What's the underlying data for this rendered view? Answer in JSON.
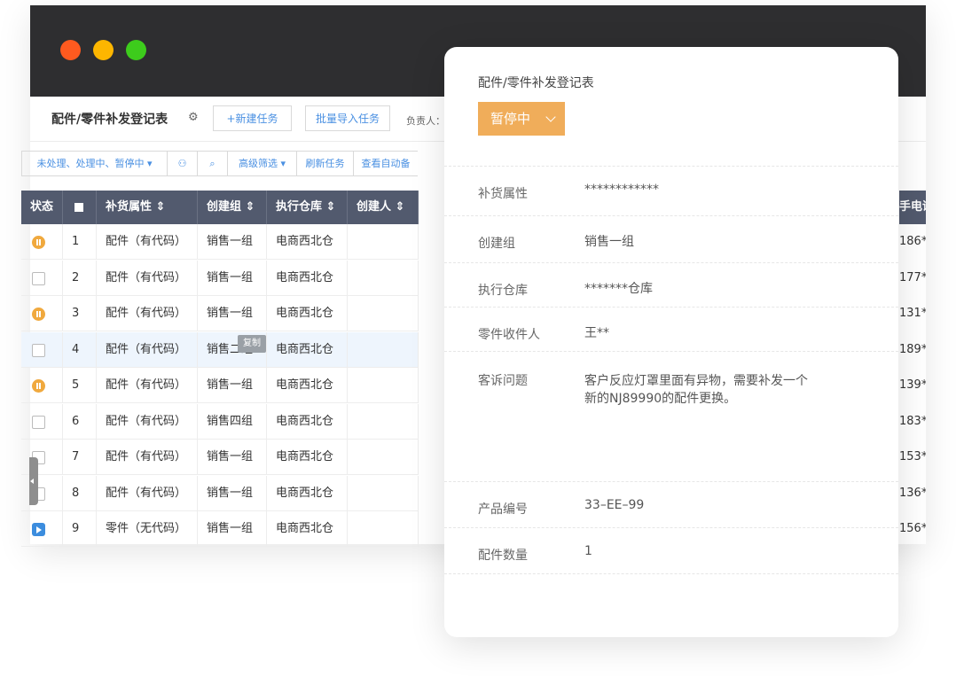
{
  "window": {
    "traffic_lights": [
      "close",
      "minimize",
      "zoom"
    ]
  },
  "toolbar": {
    "title": "配件/零件补发登记表",
    "settings_icon": "gear-icon",
    "new_task": "+新建任务",
    "batch_import": "批量导入任务",
    "owner_label": "负责人："
  },
  "filterbar": {
    "status_filter": "未处理、处理中、暂停中 ▾",
    "user_icon": "user-icon",
    "search_icon": "search-icon",
    "advanced": "高级筛选 ▾",
    "refresh": "刷新任务",
    "auto_view": "查看自动备"
  },
  "table": {
    "headers": [
      "状态",
      "",
      "补货属性 ⇕",
      "创建组 ⇕",
      "执行仓库 ⇕",
      "创建人 ⇕"
    ],
    "phone_header": "手电话",
    "rows": [
      {
        "status": "paused",
        "no": "1",
        "attr": "配件（有代码）",
        "group": "销售一组",
        "warehouse": "电商西北仓",
        "phone": "186*"
      },
      {
        "status": "pending",
        "no": "2",
        "attr": "配件（有代码）",
        "group": "销售一组",
        "warehouse": "电商西北仓",
        "phone": "177*"
      },
      {
        "status": "paused",
        "no": "3",
        "attr": "配件（有代码）",
        "group": "销售一组",
        "warehouse": "电商西北仓",
        "phone": "131*"
      },
      {
        "status": "pending",
        "no": "4",
        "attr": "配件（有代码）",
        "group": "销售二组",
        "warehouse": "电商西北仓",
        "phone": "189*"
      },
      {
        "status": "paused",
        "no": "5",
        "attr": "配件（有代码）",
        "group": "销售一组",
        "warehouse": "电商西北仓",
        "phone": "139*"
      },
      {
        "status": "pending",
        "no": "6",
        "attr": "配件（有代码）",
        "group": "销售四组",
        "warehouse": "电商西北仓",
        "phone": "183*"
      },
      {
        "status": "pending",
        "no": "7",
        "attr": "配件（有代码）",
        "group": "销售一组",
        "warehouse": "电商西北仓",
        "phone": "153*"
      },
      {
        "status": "pending",
        "no": "8",
        "attr": "配件（有代码）",
        "group": "销售一组",
        "warehouse": "电商西北仓",
        "phone": "136*"
      },
      {
        "status": "active",
        "no": "9",
        "attr": "零件（无代码）",
        "group": "销售一组",
        "warehouse": "电商西北仓",
        "phone": "156*"
      }
    ],
    "copy_tooltip": "复制"
  },
  "panel": {
    "title": "配件/零件补发登记表",
    "status": "暂停中",
    "fields": [
      {
        "label": "补货属性",
        "value": "************"
      },
      {
        "label": "创建组",
        "value": "销售一组"
      },
      {
        "label": "执行仓库",
        "value": "*******仓库"
      },
      {
        "label": "零件收件人",
        "value": "王**"
      },
      {
        "label": "客诉问题",
        "value": "客户反应灯罩里面有异物，需要补发一个",
        "value2": "新的NJ89990的配件更换。"
      },
      {
        "label": "产品编号",
        "value": "33–EE–99"
      },
      {
        "label": "配件数量",
        "value": "1"
      }
    ]
  },
  "colors": {
    "header": "#525a6e",
    "accent": "#4a90e2",
    "paused": "#f0a93e",
    "titlebar": "#2e2e30"
  }
}
